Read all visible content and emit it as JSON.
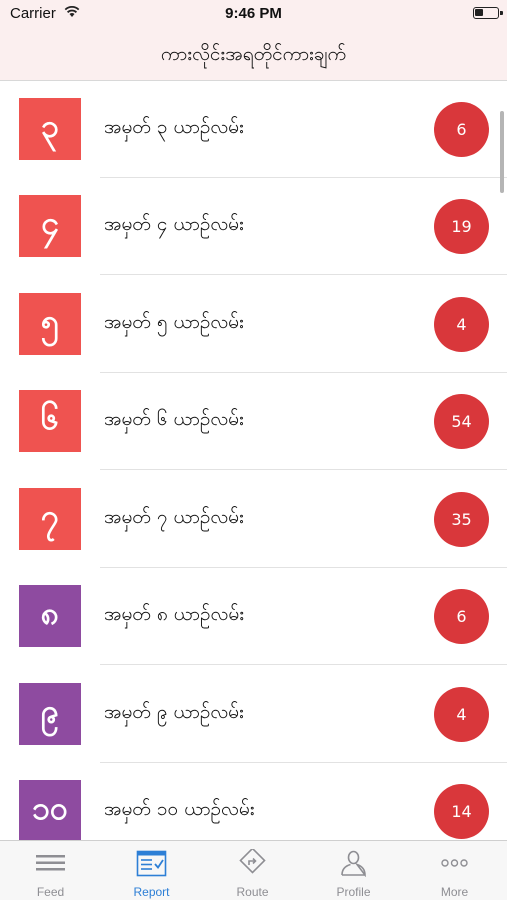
{
  "status_bar": {
    "carrier": "Carrier",
    "time": "9:46 PM"
  },
  "nav": {
    "title": "ကားလိုင်းအရတိုင်ကားချက်"
  },
  "routes": [
    {
      "badge": "၃",
      "label": "အမှတ် ၃ ယာဥ်လမ်း",
      "count": "6",
      "color": "#ef5350"
    },
    {
      "badge": "၄",
      "label": "အမှတ် ၄ ယာဥ်လမ်း",
      "count": "19",
      "color": "#ef5350"
    },
    {
      "badge": "၅",
      "label": "အမှတ် ၅ ယာဥ်လမ်း",
      "count": "4",
      "color": "#ef5350"
    },
    {
      "badge": "၆",
      "label": "အမှတ် ၆ ယာဥ်လမ်း",
      "count": "54",
      "color": "#ef5350"
    },
    {
      "badge": "၇",
      "label": "အမှတ် ၇ ယာဥ်လမ်း",
      "count": "35",
      "color": "#ef5350"
    },
    {
      "badge": "၈",
      "label": "အမှတ် ၈ ယာဥ်လမ်း",
      "count": "6",
      "color": "#8e4ba0"
    },
    {
      "badge": "၉",
      "label": "အမှတ် ၉ ယာဥ်လမ်း",
      "count": "4",
      "color": "#8e4ba0"
    },
    {
      "badge": "၁၀",
      "label": "အမှတ် ၁၀ ယာဥ်လမ်း",
      "count": "14",
      "color": "#8e4ba0"
    }
  ],
  "tabs": [
    {
      "label": "Feed",
      "icon": "feed-icon",
      "active": false
    },
    {
      "label": "Report",
      "icon": "report-icon",
      "active": true
    },
    {
      "label": "Route",
      "icon": "route-icon",
      "active": false
    },
    {
      "label": "Profile",
      "icon": "profile-icon",
      "active": false
    },
    {
      "label": "More",
      "icon": "more-icon",
      "active": false
    }
  ],
  "colors": {
    "accent": "#2d7fd6",
    "count_badge": "#d9373b",
    "inactive": "#8e8e93"
  }
}
